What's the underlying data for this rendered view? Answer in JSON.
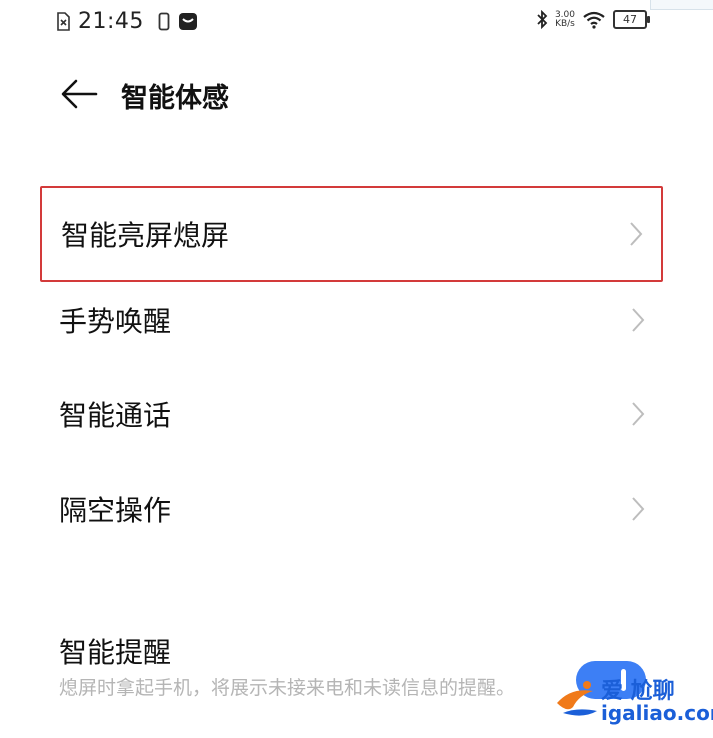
{
  "status_bar": {
    "time": "21:45",
    "speed_value": "3.00",
    "speed_unit": "KB/s",
    "battery": "47"
  },
  "header": {
    "title": "智能体感"
  },
  "menu": {
    "items": [
      {
        "label": "智能亮屏熄屏",
        "highlighted": true
      },
      {
        "label": "手势唤醒"
      },
      {
        "label": "智能通话"
      },
      {
        "label": "隔空操作"
      }
    ]
  },
  "smart_reminder": {
    "title": "智能提醒",
    "description": "熄屏时拿起手机，将展示未接来电和未读信息的提醒。",
    "enabled": true
  },
  "watermark": {
    "line1": "爱 尬聊",
    "line2": "igaliao.com"
  },
  "colors": {
    "highlight_border": "#d33a3a",
    "toggle_on": "#3d7ff5",
    "watermark": "#1b5fd8"
  }
}
